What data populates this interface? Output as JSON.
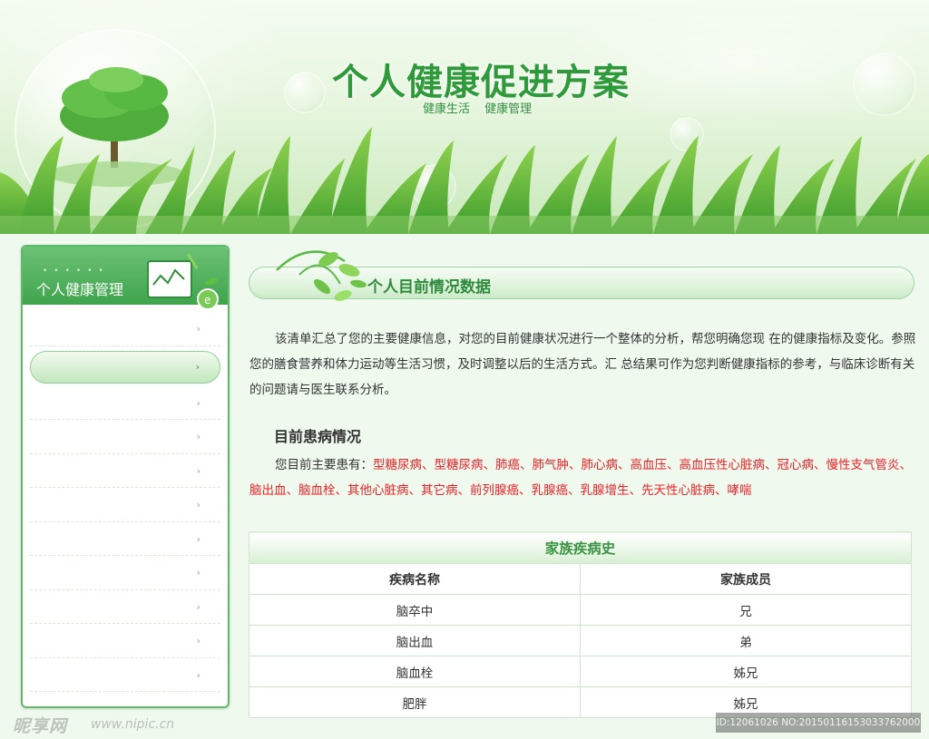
{
  "header": {
    "title": "个人健康促进方案",
    "links": [
      "健康生活",
      "健康管理"
    ]
  },
  "sidebar": {
    "title": "个人健康管理",
    "active_index": 1,
    "items": [
      "",
      "",
      "",
      "",
      "",
      "",
      "",
      "",
      "",
      "",
      ""
    ],
    "arrow": "›"
  },
  "main": {
    "section_title": "个人目前情况数据",
    "intro": "该清单汇总了您的主要健康信息，对您的目前健康状况进行一个整体的分析，帮您明确您现 在的健康指标及变化。参照您的膳食营养和体力运动等生活习惯，及时调整以后的生活方式。汇 总结果可作为您判断健康指标的参考，与临床诊断有关的问题请与医生联系分析。",
    "current_disease": {
      "heading": "目前患病情况",
      "prefix": "您目前主要患有：",
      "list": "型糖尿病、型糖尿病、肺癌、肺气肿、肺心病、高血压、高血压性心脏病、冠心病、慢性支气管炎、脑出血、脑血栓、其他心脏病、其它病、前列腺癌、乳腺癌、乳腺增生、先天性心脏病、哮喘"
    },
    "family_history": {
      "caption": "家族疾病史",
      "columns": [
        "疾病名称",
        "家族成员"
      ],
      "rows": [
        [
          "脑卒中",
          "兄"
        ],
        [
          "脑出血",
          "弟"
        ],
        [
          "脑血栓",
          "姊兄"
        ],
        [
          "肥胖",
          "姊兄"
        ]
      ]
    }
  },
  "watermark": {
    "logo": "昵享网",
    "url": "www.nipic.cn",
    "id": "ID:12061026 NO:20150116153033762000"
  },
  "colors": {
    "brand_green": "#2f9a3a",
    "sidebar_green": "#3fa44c",
    "disease_red": "#e8242a",
    "background": "#eff9ee"
  },
  "icons": [
    "tree-in-bubble-icon",
    "grass-decoration",
    "bubble-icon",
    "chart-board-icon",
    "leaf-sprig-icon",
    "chevron-right-icon"
  ]
}
